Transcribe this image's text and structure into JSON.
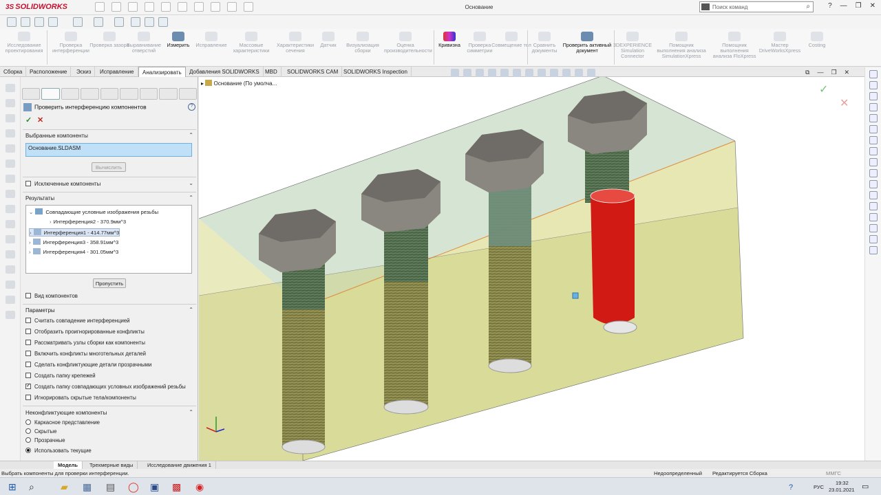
{
  "app": {
    "logo": "SOLIDWORKS",
    "title": "Основание",
    "search_placeholder": "Поиск команд",
    "help": "?"
  },
  "ribbon": [
    {
      "label": "Исследование проектирования",
      "active": false
    },
    {
      "label": "Проверка интерференции",
      "active": false
    },
    {
      "label": "Проверка зазора",
      "active": false
    },
    {
      "label": "Выравнивание отверстий",
      "active": false
    },
    {
      "label": "Измерить",
      "active": true
    },
    {
      "label": "Исправление",
      "active": false
    },
    {
      "label": "Массовые характеристики",
      "active": false
    },
    {
      "label": "Характеристики сечения",
      "active": false
    },
    {
      "label": "Датчик",
      "active": false
    },
    {
      "label": "Визуализация сборки",
      "active": false
    },
    {
      "label": "Оценка производительности",
      "active": false
    },
    {
      "label": "Кривизна",
      "active": true
    },
    {
      "label": "Проверка симметрии",
      "active": false
    },
    {
      "label": "Совмещение тел",
      "active": false
    },
    {
      "label": "Сравнить документы",
      "active": false
    },
    {
      "label": "Проверить активный документ",
      "active": true
    },
    {
      "label": "3DEXPERIENCE Simulation Connector",
      "active": false
    },
    {
      "label": "Помощник выполнения анализа SimulationXpress",
      "active": false
    },
    {
      "label": "Помощник выполнения анализа FloXpress",
      "active": false
    },
    {
      "label": "Мастер DriveWorksXpress",
      "active": false
    },
    {
      "label": "Costing",
      "active": false
    }
  ],
  "tabs": [
    "Сборка",
    "Расположение",
    "Эскиз",
    "Исправление",
    "Анализировать",
    "Добавления SOLIDWORKS",
    "MBD",
    "SOLIDWORKS CAM",
    "SOLIDWORKS Inspection"
  ],
  "active_tab": "Анализировать",
  "panel": {
    "title": "Проверить интерференцию компонентов",
    "ok": "✓",
    "cancel": "✕",
    "selected_header": "Выбранные компоненты",
    "selected_value": "Основание.SLDASM",
    "calc_button": "Вычислить",
    "excluded_header": "Исключенные компоненты",
    "results_header": "Результаты",
    "results": {
      "folder": "Совпадающие условные изображения резьбы",
      "folder_child": "Интерференция2 - 370.9мм^3",
      "items": [
        "Интерференция1 - 414.77мм^3",
        "Интерференция3 - 358.91мм^3",
        "Интерференция4 - 301.05мм^3"
      ]
    },
    "skip_button": "Пропустить",
    "view_components": "Вид компонентов",
    "params_header": "Параметры",
    "params": [
      {
        "label": "Считать совпадение интерференцией",
        "checked": false
      },
      {
        "label": "Отобразить проигнорированные конфликты",
        "checked": false
      },
      {
        "label": "Рассматривать узлы сборки как компоненты",
        "checked": false
      },
      {
        "label": "Включить конфликты многотельных деталей",
        "checked": false
      },
      {
        "label": "Сделать конфликтующие детали прозрачными",
        "checked": false
      },
      {
        "label": "Создать папку крепежей",
        "checked": false
      },
      {
        "label": "Создать папку совпадающих условных изображений резьбы",
        "checked": true
      },
      {
        "label": "Игнорировать скрытые тела/компоненты",
        "checked": false
      }
    ],
    "nonconf_header": "Неконфликтующие компоненты",
    "nonconf": [
      {
        "label": "Каркасное представление",
        "selected": false
      },
      {
        "label": "Скрытые",
        "selected": false
      },
      {
        "label": "Прозрачные",
        "selected": false
      },
      {
        "label": "Использовать текущие",
        "selected": true
      }
    ]
  },
  "tree_label": "Основание  (По умолча...",
  "bottom_tabs": [
    "Модель",
    "Трехмерные виды",
    "Исследование движения 1"
  ],
  "status": {
    "left": "Выбрать компоненты для проверки интерференции.",
    "mid1": "Недоопределенный",
    "mid2": "Редактируется Сборка",
    "mmgs": "ММГС"
  },
  "taskbar": {
    "lang": "РУС",
    "time": "19:32",
    "date": "23.01.2021"
  },
  "colors": {
    "accent": "#c8102e",
    "selection": "#bfe0f6",
    "interference": "#d11a14",
    "block_top": "#9fbf9a",
    "block_side": "#d6d77e"
  }
}
